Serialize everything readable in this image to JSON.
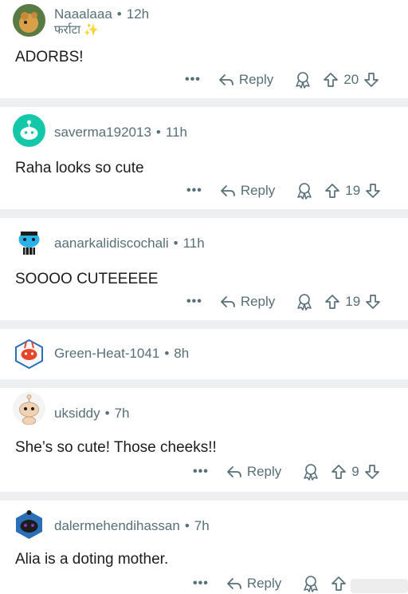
{
  "comments": [
    {
      "username": "Naaalaaa",
      "age": "12h",
      "flair": "फर्राटा",
      "flair_icon": "sparkles-icon",
      "text": "ADORBS!",
      "votes": "20",
      "reply_label": "Reply",
      "avatar": {
        "bg": "#4a6a3a",
        "fg": "#d9a04a",
        "icon": "animal-avatar"
      }
    },
    {
      "username": "saverma192013",
      "age": "11h",
      "text": "Raha looks so cute",
      "votes": "19",
      "reply_label": "Reply",
      "avatar": {
        "bg": "#12c8a8",
        "fg": "#ffffff",
        "icon": "snoo-default-avatar"
      }
    },
    {
      "username": "aanarkalidiscochali",
      "age": "11h",
      "text": "SOOOO CUTEEEEE",
      "votes": "19",
      "reply_label": "Reply",
      "avatar": {
        "bg": "#ffffff",
        "fg": "#2ab1e8",
        "icon": "snoo-blue-avatar"
      }
    },
    {
      "username": "Green-Heat-1041",
      "age": "8h",
      "text": "",
      "votes": "",
      "reply_label": "",
      "avatar": {
        "bg": "#ffffff",
        "fg": "#e8462c",
        "icon": "snoo-red-avatar"
      }
    },
    {
      "username": "uksiddy",
      "age": "7h",
      "text": "She’s so cute! Those cheeks!!",
      "votes": "9",
      "reply_label": "Reply",
      "avatar": {
        "bg": "#f4f4f4",
        "fg": "#f1d3b3",
        "icon": "snoo-beige-avatar"
      }
    },
    {
      "username": "dalermehendihassan",
      "age": "7h",
      "text": "Alia is a doting mother.",
      "votes": "",
      "reply_label": "Reply",
      "avatar": {
        "bg": "#ffffff",
        "fg": "#7a3db8",
        "icon": "snoo-purple-avatar"
      }
    }
  ],
  "more_label": "•••",
  "dot": "•"
}
